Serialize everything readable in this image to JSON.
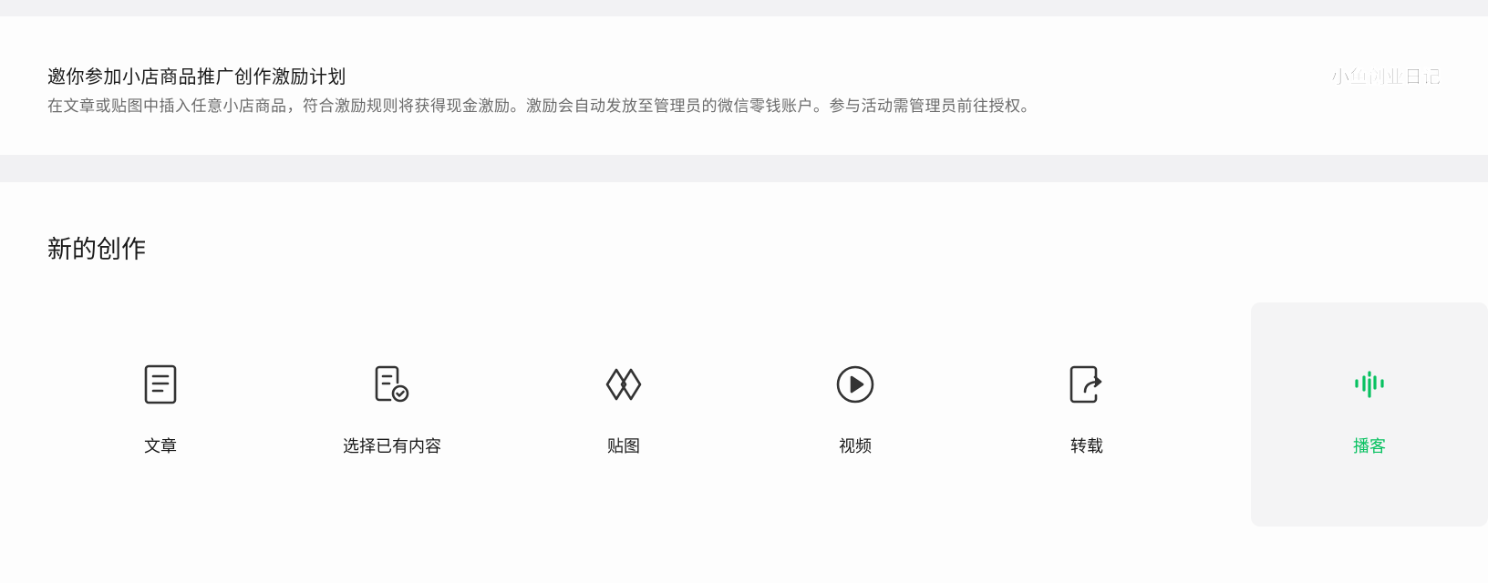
{
  "banner": {
    "title": "邀你参加小店商品推广创作激励计划",
    "description": "在文章或贴图中插入任意小店商品，符合激励规则将获得现金激励。激励会自动发放至管理员的微信零钱账户。参与活动需管理员前往授权。",
    "watermark": "小鱼创业日记"
  },
  "create": {
    "title": "新的创作",
    "items": [
      {
        "label": "文章",
        "icon": "document-icon"
      },
      {
        "label": "选择已有内容",
        "icon": "document-check-icon"
      },
      {
        "label": "贴图",
        "icon": "image-diamond-icon"
      },
      {
        "label": "视频",
        "icon": "play-circle-icon"
      },
      {
        "label": "转载",
        "icon": "share-document-icon"
      },
      {
        "label": "播客",
        "icon": "audio-wave-icon"
      }
    ],
    "active_item": "播客"
  },
  "colors": {
    "accent": "#07c160",
    "text": "#1a1a1a",
    "muted": "#6b6b6b",
    "icon": "#333333"
  }
}
